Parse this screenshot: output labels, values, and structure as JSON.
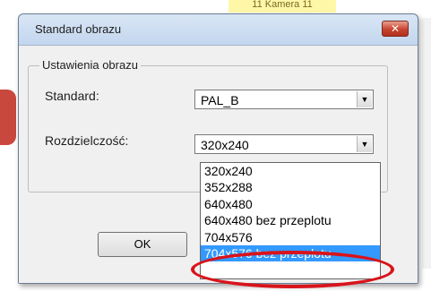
{
  "background": {
    "caption": "11 Kamera 11"
  },
  "dialog": {
    "title": "Standard obrazu",
    "close_glyph": "✕",
    "group_label": "Ustawienia obrazu",
    "standard": {
      "label": "Standard:",
      "value": "PAL_B"
    },
    "resolution": {
      "label": "Rozdzielczość:",
      "value": "320x240"
    },
    "ok_label": "OK"
  },
  "dropdown": {
    "options": [
      "320x240",
      "352x288",
      "640x480",
      "640x480 bez przeplotu",
      "704x576",
      "704x576 bez przeplotu"
    ],
    "selected_index": 5,
    "highlight_color": "#3399ff",
    "annotation_color": "#d8141b"
  }
}
